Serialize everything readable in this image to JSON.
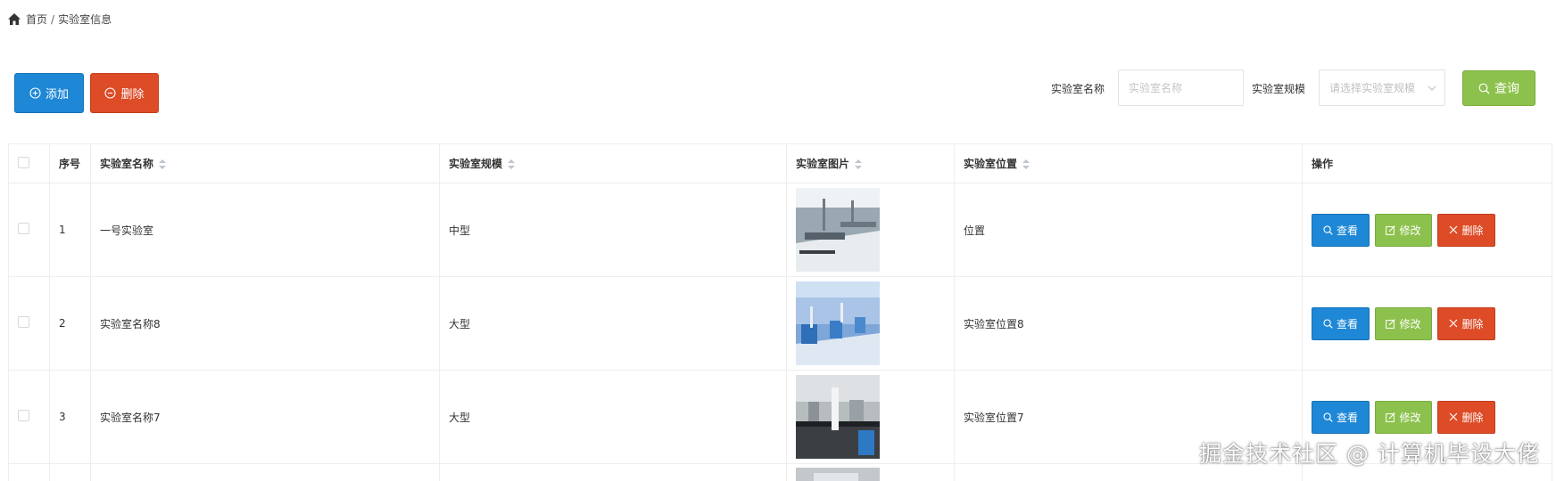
{
  "breadcrumb": {
    "home": "首页",
    "separator": "/",
    "current": "实验室信息"
  },
  "toolbar": {
    "add_label": "添加",
    "delete_label": "删除"
  },
  "search": {
    "name_label": "实验室名称",
    "name_placeholder": "实验室名称",
    "scale_label": "实验室规模",
    "scale_placeholder": "请选择实验室规模",
    "query_label": "查询"
  },
  "table": {
    "columns": [
      "序号",
      "实验室名称",
      "实验室规模",
      "实验室图片",
      "实验室位置",
      "操作"
    ],
    "rows": [
      {
        "index": "1",
        "name": "一号实验室",
        "scale": "中型",
        "location": "位置"
      },
      {
        "index": "2",
        "name": "实验室名称8",
        "scale": "大型",
        "location": "实验室位置8"
      },
      {
        "index": "3",
        "name": "实验室名称7",
        "scale": "大型",
        "location": "实验室位置7"
      }
    ],
    "actions": {
      "view": "查看",
      "edit": "修改",
      "delete": "删除"
    }
  },
  "watermark": "掘金技术社区 @ 计算机毕设大佬",
  "colors": {
    "primary": "#1e88d6",
    "success": "#8dc14d",
    "danger": "#dd4b27"
  }
}
